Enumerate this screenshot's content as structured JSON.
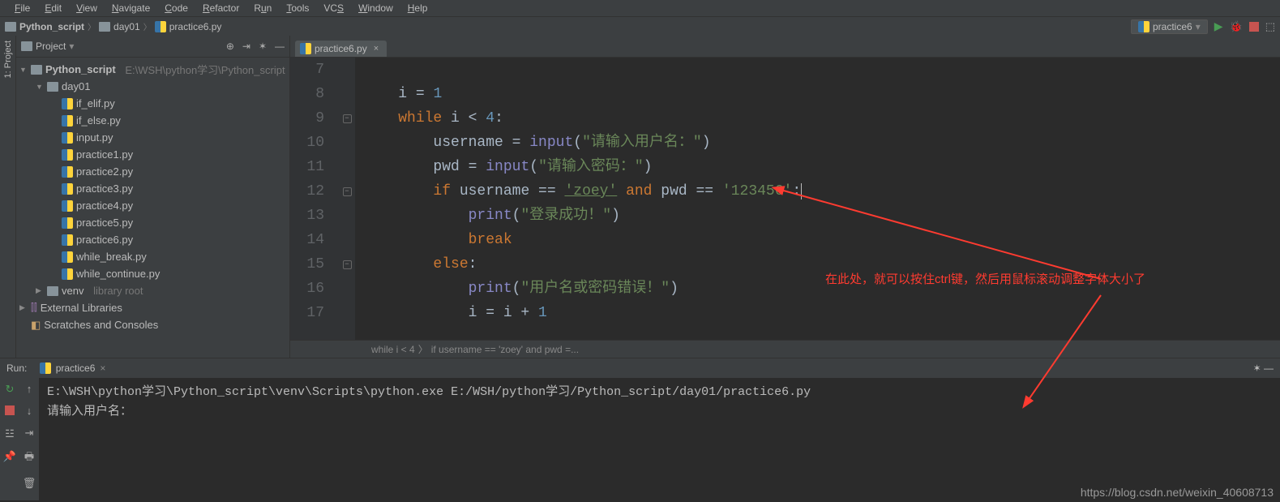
{
  "menu": {
    "items": [
      "File",
      "Edit",
      "View",
      "Navigate",
      "Code",
      "Refactor",
      "Run",
      "Tools",
      "VCS",
      "Window",
      "Help"
    ]
  },
  "breadcrumb": {
    "root": "Python_script",
    "dir": "day01",
    "file": "practice6.py"
  },
  "run_config": {
    "name": "practice6"
  },
  "project": {
    "panel_title": "Project",
    "root_name": "Python_script",
    "root_path": "E:\\WSH\\python学习\\Python_script",
    "day_dir": "day01",
    "files": [
      "if_elif.py",
      "if_else.py",
      "input.py",
      "practice1.py",
      "practice2.py",
      "practice3.py",
      "practice4.py",
      "practice5.py",
      "practice6.py",
      "while_break.py",
      "while_continue.py"
    ],
    "venv": "venv",
    "venv_suffix": "library root",
    "ext_lib": "External Libraries",
    "scratches": "Scratches and Consoles"
  },
  "editor": {
    "tab": "practice6.py",
    "lines": {
      "l7": "7",
      "l8": "8",
      "l9": "9",
      "l10": "10",
      "l11": "11",
      "l12": "12",
      "l13": "13",
      "l14": "14",
      "l15": "15",
      "l16": "16",
      "l17": "17"
    },
    "code": {
      "c7": "",
      "c8_pre": "    ",
      "c8_i": "i",
      "c8_eq": " = ",
      "c8_1": "1",
      "c9_pre": "    ",
      "c9_while": "while",
      "c9_cond": " i < ",
      "c9_4": "4",
      "c9_colon": ":",
      "c10_pre": "        ",
      "c10_u": "username = ",
      "c10_input": "input",
      "c10_p": "(",
      "c10_s": "\"请输入用户名：\"",
      "c10_e": ")",
      "c11_pre": "        ",
      "c11_p": "pwd = ",
      "c11_input": "input",
      "c11_pp": "(",
      "c11_s": "\"请输入密码：\"",
      "c11_e": ")",
      "c12_pre": "        ",
      "c12_if": "if",
      "c12_a": " username == ",
      "c12_s1": "'zoey'",
      "c12_and": " and ",
      "c12_b": "pwd == ",
      "c12_s2": "'123456'",
      "c12_c": ":",
      "c13_pre": "            ",
      "c13_print": "print",
      "c13_p": "(",
      "c13_s": "\"登录成功！\"",
      "c13_e": ")",
      "c14_pre": "            ",
      "c14_break": "break",
      "c15_pre": "        ",
      "c15_else": "else",
      "c15_c": ":",
      "c16_pre": "            ",
      "c16_print": "print",
      "c16_p": "(",
      "c16_s": "\"用户名或密码错误！\"",
      "c16_e": ")",
      "c17_pre": "            ",
      "c17": "i = i + ",
      "c17_1": "1"
    },
    "crumb1": "while i < 4",
    "crumb2": "if username == 'zoey' and pwd =..."
  },
  "annotation": "在此处，就可以按住ctrl键，然后用鼠标滚动调整字体大小了",
  "run": {
    "title": "Run:",
    "tab": "practice6",
    "line1": "E:\\WSH\\python学习\\Python_script\\venv\\Scripts\\python.exe E:/WSH/python学习/Python_script/day01/practice6.py",
    "line2": "请输入用户名："
  },
  "watermark": "https://blog.csdn.net/weixin_40608713"
}
